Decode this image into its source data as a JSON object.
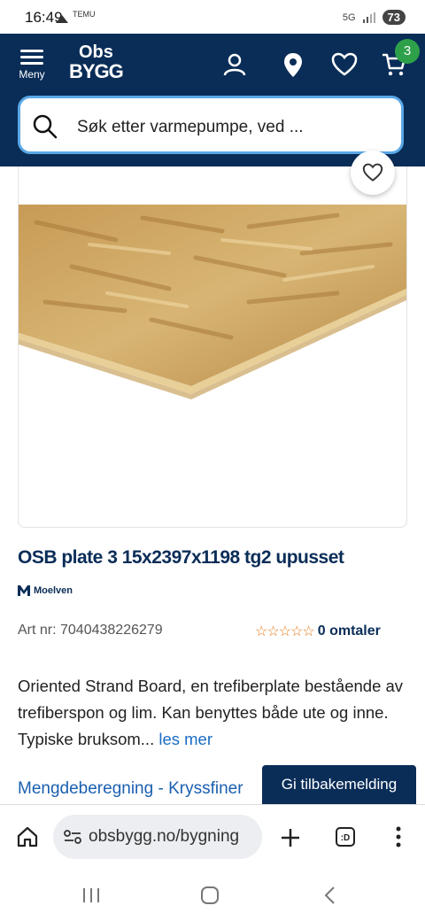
{
  "status": {
    "time": "16:49",
    "temu": "TEMU",
    "net": "5G",
    "battery": "73"
  },
  "header": {
    "menu_label": "Meny",
    "logo_line1": "Obs",
    "logo_line2": "BYGG",
    "cart_count": "3"
  },
  "search": {
    "placeholder": "Søk etter varmepumpe, ved ..."
  },
  "product": {
    "title": "OSB plate 3 15x2397x1198 tg2 upusset",
    "brand": "Moelven",
    "art_nr": "Art nr: 7040438226279",
    "stars": "☆☆☆☆☆",
    "reviews": "0 omtaler",
    "description": "Oriented Strand Board, en trefiberplate bestående av trefiberspon og lim. Kan benyttes både ute og inne. Typiske bruksom...",
    "read_more": "les mer",
    "calc_link": "Mengdeberegning - Kryssfiner",
    "feedback_button": "Gi tilbakemelding"
  },
  "browser": {
    "url": "obsbygg.no/bygning",
    "tab_label": ":D"
  },
  "colors": {
    "brand_navy": "#0a2d58",
    "badge_green": "#2ea04a",
    "link_blue": "#1a6cc4",
    "star_orange": "#e07b1a"
  }
}
